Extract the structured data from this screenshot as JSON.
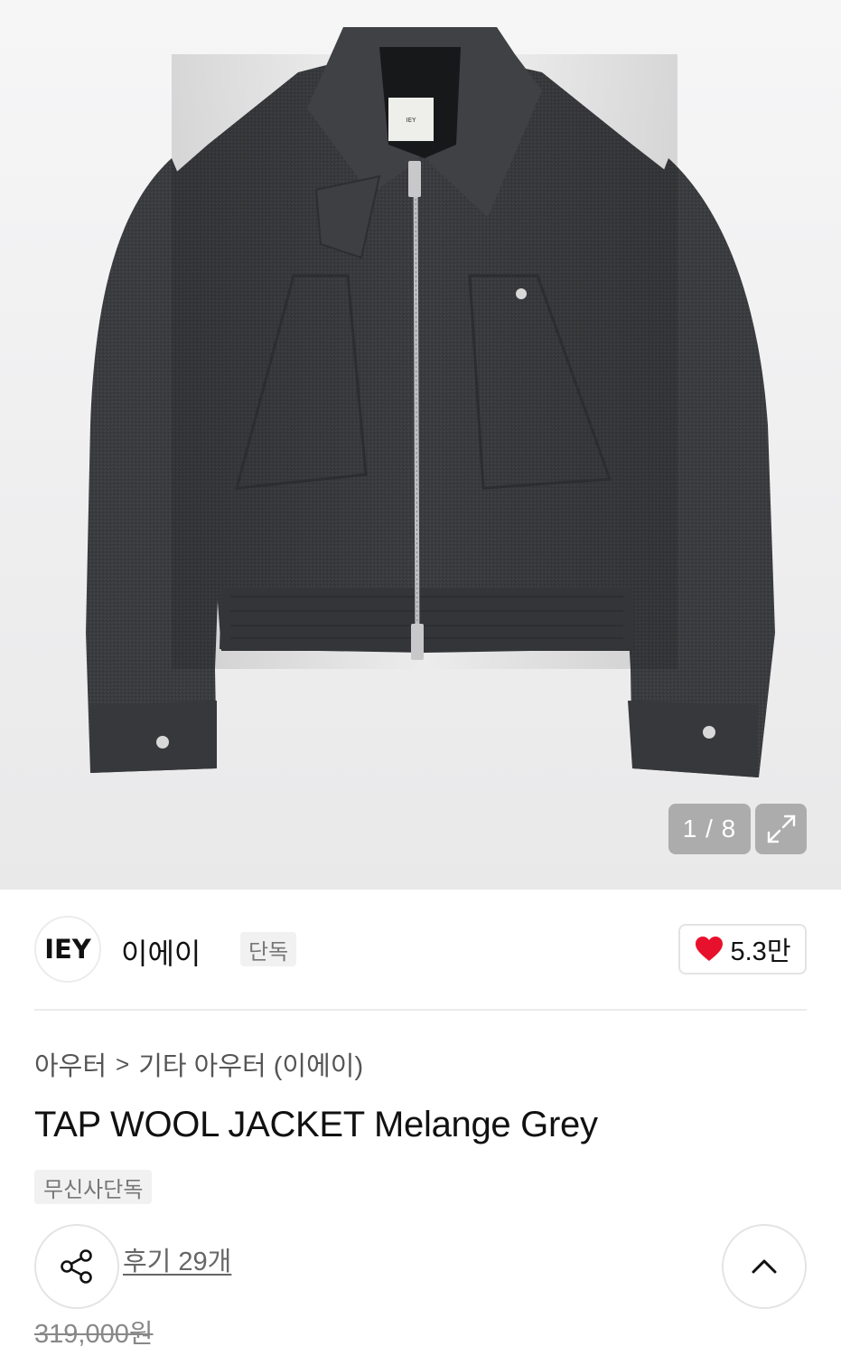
{
  "gallery": {
    "counter": "1 / 8",
    "image_alt": "TAP WOOL JACKET Melange Grey",
    "label_tag": "IEY"
  },
  "brand": {
    "logo_text": "IEY",
    "name": "이에이",
    "tag": "단독",
    "likes": "5.3만"
  },
  "breadcrumb": {
    "category": "아우터",
    "separator": ">",
    "subcategory": "기타 아우터 (이에이)"
  },
  "product": {
    "title": "TAP WOOL JACKET Melange Grey",
    "exclusive_tag": "무신사단독",
    "reviews": "후기 29개",
    "original_price": "319,000원"
  },
  "icons": {
    "expand": "expand-icon",
    "heart": "heart-icon",
    "share": "share-icon",
    "scroll_top": "chevron-up-icon"
  },
  "colors": {
    "heart": "#e8112d",
    "jacket": "#3a3b3e",
    "background": "#f2f2f3"
  }
}
